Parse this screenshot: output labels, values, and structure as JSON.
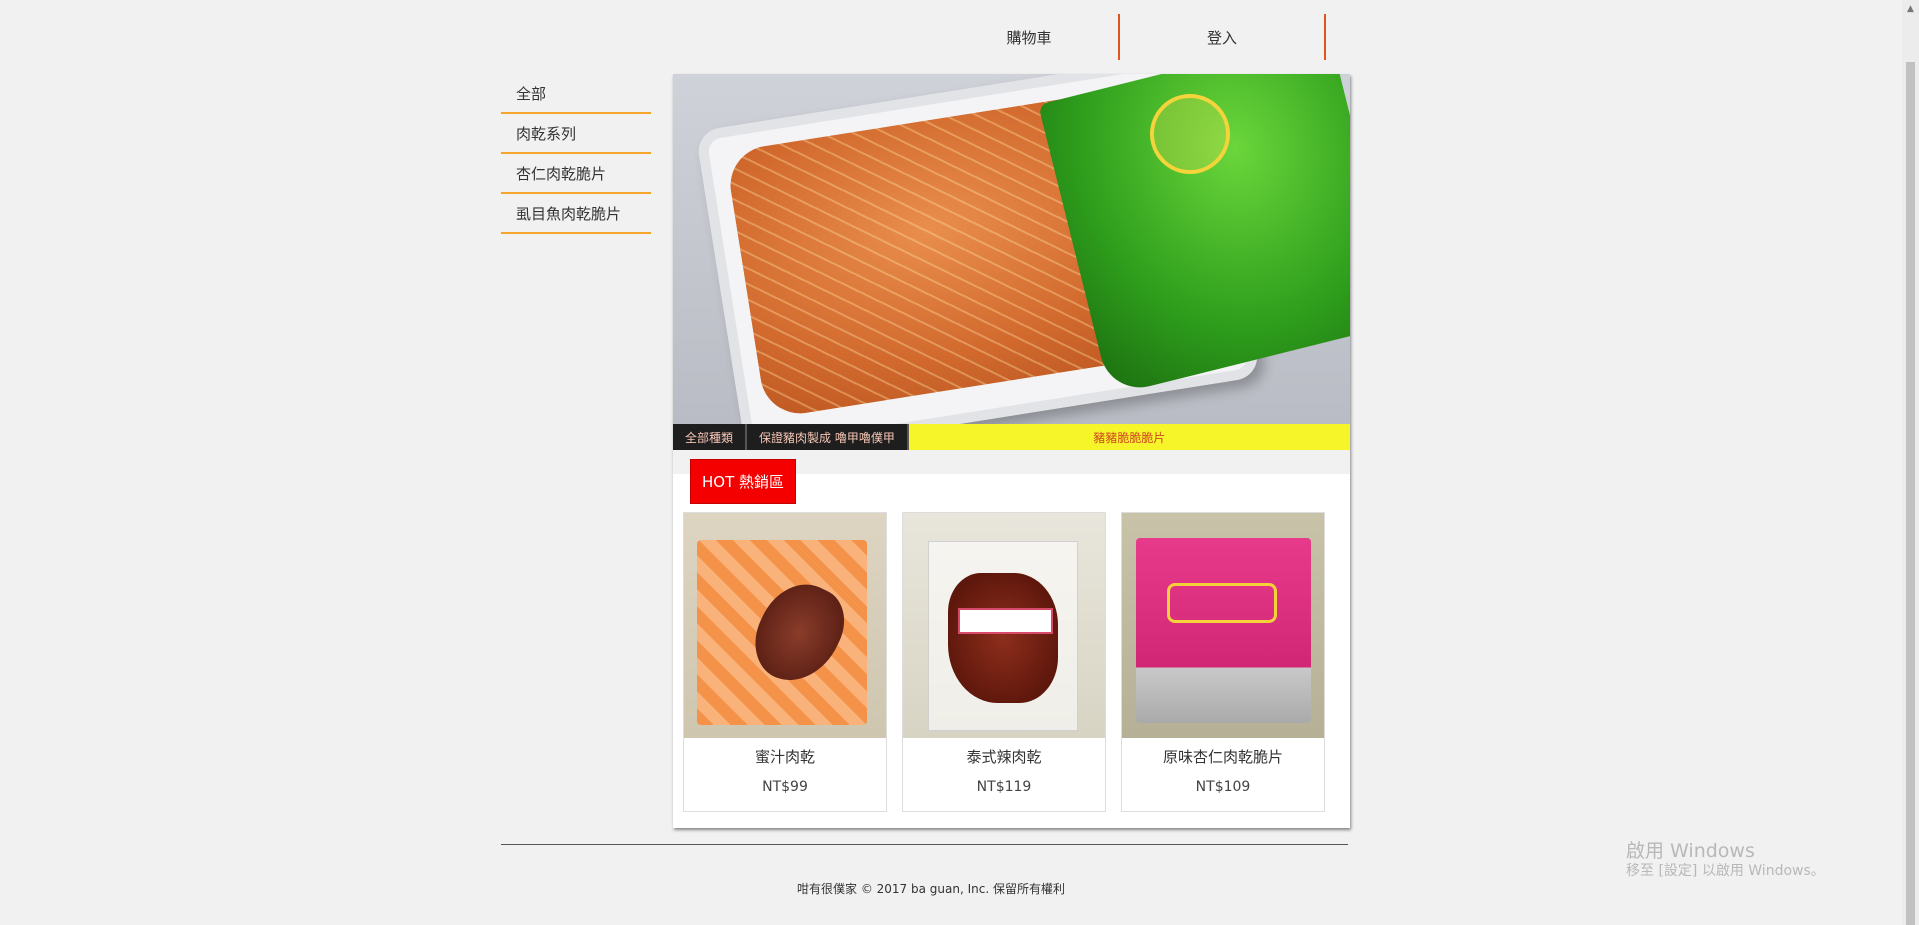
{
  "nav": {
    "cart_label": "購物車",
    "login_label": "登入"
  },
  "sidebar": {
    "items": [
      {
        "label": "全部"
      },
      {
        "label": "肉乾系列"
      },
      {
        "label": "杏仁肉乾脆片"
      },
      {
        "label": "虱目魚肉乾脆片"
      }
    ]
  },
  "banner": {
    "captions": [
      "全部種類",
      "保證豬肉製成  嚕甲嚕僕甲",
      "豬豬脆脆脆片"
    ]
  },
  "hot_section": {
    "label": "HOT 熱銷區",
    "products": [
      {
        "name": "蜜汁肉乾",
        "price": "NT$99"
      },
      {
        "name": "泰式辣肉乾",
        "price": "NT$119"
      },
      {
        "name": "原味杏仁肉乾脆片",
        "price": "NT$109"
      }
    ]
  },
  "footer": {
    "copyright": "咁有很僕家 © 2017 ba guan, Inc. 保留所有權利"
  },
  "watermark": {
    "title": "啟用 Windows",
    "subtitle": "移至 [設定] 以啟用 Windows。"
  },
  "colors": {
    "accent_orange": "#f5a52b",
    "nav_border": "#e0541f",
    "hot_red": "#f40000",
    "caption_yellow": "#f5f52a"
  }
}
